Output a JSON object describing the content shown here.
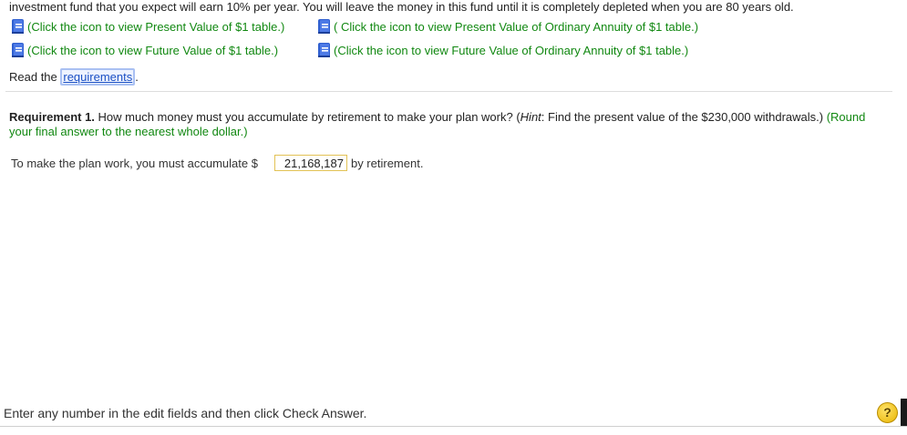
{
  "intro_text": "investment fund that you expect will earn 10% per year. You will leave the money in this fund until it is completely depleted when you are 80 years old.",
  "table_links": {
    "pv": "(Click the icon to view Present Value of $1 table.)",
    "pvoa": "( Click the icon to view Present Value of Ordinary Annuity of $1 table.)",
    "fv": "(Click the icon to view Future Value of $1 table.)",
    "fvoa": "(Click the icon to view Future Value of Ordinary Annuity of $1 table.)"
  },
  "read": {
    "prefix": "Read the ",
    "link": "requirements",
    "suffix": "."
  },
  "requirement": {
    "label": "Requirement 1.",
    "question": " How much money must you accumulate by retirement to make your plan work? (",
    "hint_label": "Hint",
    "hint_text": ": Find the present value of the $230,000 withdrawals.) ",
    "round_text": "(Round your final answer to the nearest whole dollar.)"
  },
  "answer": {
    "prefix": "To make the plan work, you must accumulate $",
    "value": "21,168,187",
    "suffix": "by retirement."
  },
  "footer": {
    "instruction": "Enter any number in the edit fields and then click Check Answer.",
    "help": "?"
  },
  "colors": {
    "link_green": "#118811",
    "link_blue": "#1a4fc4",
    "icon_blue": "#2f5fd0",
    "help_yellow": "#e8b400"
  },
  "icons": {
    "table": "book-icon",
    "help": "help-icon"
  }
}
